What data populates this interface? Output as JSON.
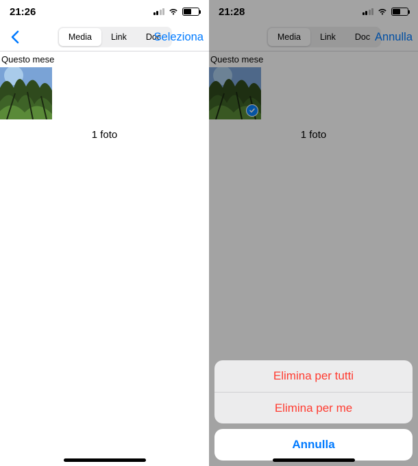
{
  "screens": {
    "a": {
      "status": {
        "time": "21:26",
        "battery_pct": 52
      },
      "nav": {
        "tabs": [
          "Media",
          "Link",
          "Doc"
        ],
        "active_tab": 0,
        "action_label": "Seleziona"
      },
      "section_title": "Questo mese",
      "photo_count_label": "1 foto"
    },
    "b": {
      "status": {
        "time": "21:28",
        "battery_pct": 52
      },
      "nav": {
        "tabs": [
          "Media",
          "Link",
          "Doc"
        ],
        "active_tab": 0,
        "action_label": "Annulla"
      },
      "section_title": "Questo mese",
      "photo_count_label": "1 foto",
      "sheet": {
        "options": [
          "Elimina per tutti",
          "Elimina per me"
        ],
        "cancel": "Annulla"
      }
    }
  },
  "colors": {
    "ios_blue": "#007aff",
    "ios_red": "#ff3b30"
  }
}
